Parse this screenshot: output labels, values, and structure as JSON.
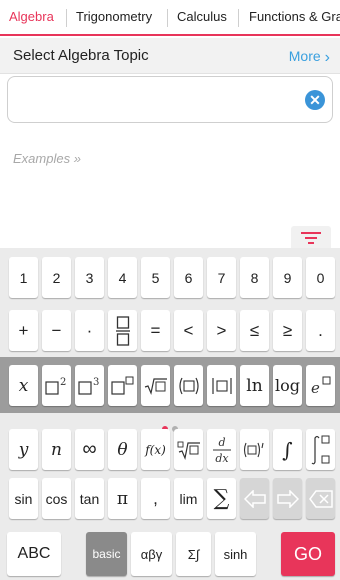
{
  "tabs": [
    {
      "label": "Algebra",
      "active": true
    },
    {
      "label": "Trigonometry",
      "active": false
    },
    {
      "label": "Calculus",
      "active": false
    },
    {
      "label": "Functions & Gra",
      "active": false
    }
  ],
  "topic_bar": {
    "title": "Select Algebra Topic",
    "more_label": "More"
  },
  "input": {
    "value": "",
    "placeholder": ""
  },
  "examples_label": "Examples »",
  "colors": {
    "accent": "#e8355a",
    "link": "#3aa0df",
    "clear": "#3a94d8",
    "go": "#e8355a"
  },
  "keyboard": {
    "digits": [
      "1",
      "2",
      "3",
      "4",
      "5",
      "6",
      "7",
      "8",
      "9",
      "0"
    ],
    "operators": [
      "+",
      "−",
      "·",
      "□/□",
      "=",
      "<",
      ">",
      "≤",
      "≥",
      "."
    ],
    "templates": [
      "x",
      "□²",
      "□³",
      "□^□",
      "√□",
      "(□)",
      "|□|",
      "ln",
      "log",
      "e^□"
    ],
    "row_functions": [
      "y",
      "n",
      "∞",
      "θ",
      "f(x)",
      "ⁿ√□",
      "d/dx",
      "(□)′",
      "∫",
      "∫□"
    ],
    "row_misc": [
      "sin",
      "cos",
      "tan",
      "π",
      ",",
      "lim",
      "∑",
      "arrow-left-icon",
      "arrow-right-icon",
      "backspace-icon"
    ],
    "bottom": {
      "abc": "ABC",
      "basic": "basic",
      "greek": "αβγ",
      "calc": "Σ∫",
      "hyper": "sinh",
      "go": "GO"
    },
    "page_indicator": {
      "pages": 2,
      "current": 1
    }
  }
}
